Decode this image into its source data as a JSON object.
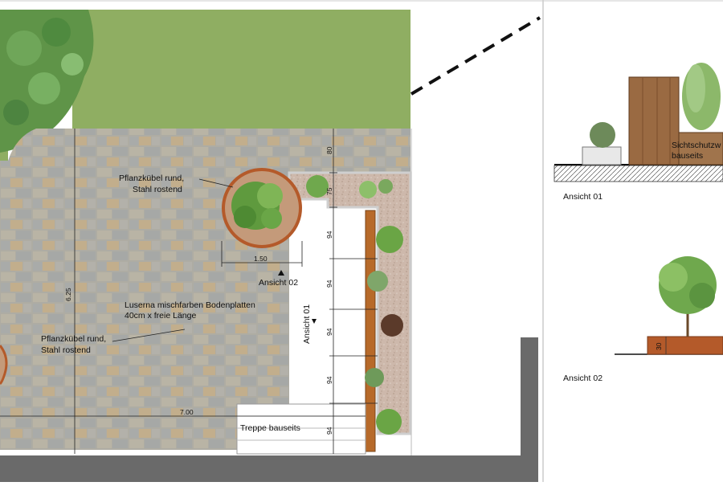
{
  "plan": {
    "annotations": {
      "planter_top_line1": "Pflanzkübel rund,",
      "planter_top_line2": "Stahl rostend",
      "planter_left_line1": "Pflanzkübel rund,",
      "planter_left_line2": "Stahl rostend",
      "paving_line1": "Luserna mischfarben Bodenplatten",
      "paving_line2": "40cm x freie Länge",
      "stairs": "Treppe bauseits",
      "view01_marker": "Ansicht 01",
      "view02_marker": "Ansicht 02"
    },
    "dimensions": {
      "planter_width": "1.50",
      "total_height": "6.25",
      "total_width": "7.00",
      "segment_80": "80",
      "segment_75": "75",
      "segment_94_a": "94",
      "segment_94_b": "94",
      "segment_94_c": "94",
      "segment_94_d": "94",
      "segment_94_e": "94"
    }
  },
  "elevations": {
    "view01": {
      "title": "Ansicht 01",
      "screen_label_line1": "Sichtschutzw",
      "screen_label_line2": "bauseits"
    },
    "view02": {
      "title": "Ansicht 02",
      "planter_height": "30"
    }
  },
  "colors": {
    "lawn": "#8fae62",
    "paving": "#b0aea4",
    "gravel_bed": "#cdb8ab",
    "rust_steel": "#b45a2a",
    "wood": "#9a6a42",
    "wall": "#6a6a6a"
  }
}
